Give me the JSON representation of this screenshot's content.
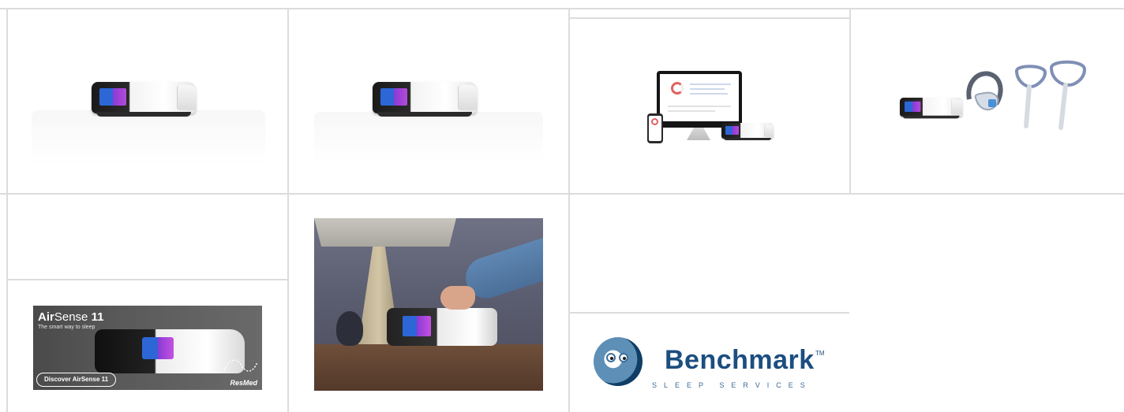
{
  "gallery": {
    "banner": {
      "title_brand": "Air",
      "title_model": "Sense",
      "title_number": "11",
      "subtitle": "The smart way to sleep",
      "cta": "Discover AirSense 11",
      "brand": "ResMed"
    },
    "logo": {
      "name": "Benchmark",
      "trademark": "TM",
      "tagline": "SLEEP SERVICES"
    }
  }
}
